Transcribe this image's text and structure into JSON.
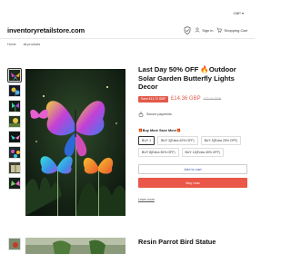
{
  "header": {
    "currency": "GBP",
    "logo": "inventoryretailstore.com",
    "signin_label": "Sign in",
    "cart_label": "Shopping Cart"
  },
  "breadcrumb": [
    "Home",
    "all-products"
  ],
  "product": {
    "title": "Last Day 50% OFF 🔥Outdoor Solar Garden Butterfly Lights Decor",
    "save_badge": "Save £11.72 GBP",
    "price": "£14.36 GBP",
    "old_price": "£23.44 GBP",
    "secure_label": "Secure payments",
    "promo_label": "🎁Buy More Save More🎁",
    "options": [
      {
        "label": "BUY 1",
        "selected": true
      },
      {
        "label": "BUY 2(Extra 20% OFF)",
        "selected": false
      },
      {
        "label": "BUY 3(Extra 25% OFF)",
        "selected": false
      },
      {
        "label": "BUY 8(Extra 30% OFF)",
        "selected": false
      },
      {
        "label": "BUY 12(Extra 40% OFF)",
        "selected": false
      }
    ],
    "add_to_cart": "Add to cart",
    "buy_now": "Buy now",
    "checkout_link": "Learn more"
  },
  "next_product": {
    "title": "Resin Parrot Bird Statue"
  },
  "colors": {
    "accent_red": "#ea5647",
    "link_blue": "#3a5bb0"
  }
}
